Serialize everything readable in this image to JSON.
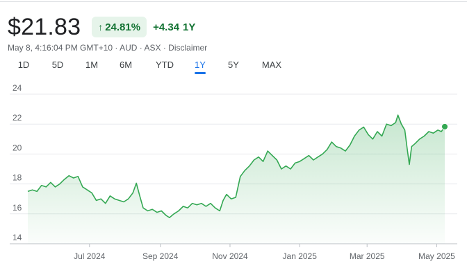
{
  "header": {
    "price": "$21.83",
    "percent_change": "24.81%",
    "arrow_icon": "arrow-up-icon",
    "arrow_glyph": "↑",
    "abs_change": "+4.34",
    "period_label": "1Y"
  },
  "meta": {
    "timestamp": "May 8, 4:16:04 PM GMT+10",
    "sep": "·",
    "currency": "AUD",
    "exchange": "ASX",
    "disclaimer": "Disclaimer"
  },
  "tabs": [
    {
      "label": "1D",
      "active": false
    },
    {
      "label": "5D",
      "active": false
    },
    {
      "label": "1M",
      "active": false
    },
    {
      "label": "6M",
      "active": false
    },
    {
      "label": "YTD",
      "active": false
    },
    {
      "label": "1Y",
      "active": true
    },
    {
      "label": "5Y",
      "active": false
    },
    {
      "label": "MAX",
      "active": false
    }
  ],
  "colors": {
    "line": "#34a853",
    "fill_top": "#34a853",
    "grid": "#e8eaed",
    "axis": "#bdc1c6",
    "accent": "#1a73e8"
  },
  "chart_data": {
    "type": "area",
    "title": "",
    "xlabel": "",
    "ylabel": "",
    "ylim": [
      14,
      24
    ],
    "yticks": [
      14,
      16,
      18,
      20,
      22,
      24
    ],
    "xlim": [
      "2024-05-08",
      "2025-05-08"
    ],
    "xticks": [
      {
        "label": "Jul 2024",
        "date": "2024-07-01"
      },
      {
        "label": "Sep 2024",
        "date": "2024-09-01"
      },
      {
        "label": "Nov 2024",
        "date": "2024-11-01"
      },
      {
        "label": "Jan 2025",
        "date": "2025-01-01"
      },
      {
        "label": "Mar 2025",
        "date": "2025-03-01"
      },
      {
        "label": "May 2025",
        "date": "2025-05-01"
      }
    ],
    "grid": true,
    "series": [
      {
        "points": [
          [
            "2024-05-08",
            17.5
          ],
          [
            "2024-05-12",
            17.6
          ],
          [
            "2024-05-16",
            17.5
          ],
          [
            "2024-05-20",
            17.9
          ],
          [
            "2024-05-24",
            17.8
          ],
          [
            "2024-05-28",
            18.1
          ],
          [
            "2024-06-01",
            17.8
          ],
          [
            "2024-06-05",
            18.0
          ],
          [
            "2024-06-09",
            18.3
          ],
          [
            "2024-06-13",
            18.55
          ],
          [
            "2024-06-17",
            18.4
          ],
          [
            "2024-06-21",
            18.5
          ],
          [
            "2024-06-25",
            17.8
          ],
          [
            "2024-06-29",
            17.6
          ],
          [
            "2024-07-03",
            17.4
          ],
          [
            "2024-07-07",
            16.9
          ],
          [
            "2024-07-11",
            17.0
          ],
          [
            "2024-07-15",
            16.7
          ],
          [
            "2024-07-19",
            17.2
          ],
          [
            "2024-07-23",
            17.0
          ],
          [
            "2024-07-27",
            16.9
          ],
          [
            "2024-07-31",
            16.8
          ],
          [
            "2024-08-04",
            17.0
          ],
          [
            "2024-08-08",
            17.4
          ],
          [
            "2024-08-11",
            18.05
          ],
          [
            "2024-08-14",
            17.2
          ],
          [
            "2024-08-17",
            16.4
          ],
          [
            "2024-08-21",
            16.2
          ],
          [
            "2024-08-25",
            16.3
          ],
          [
            "2024-08-29",
            16.1
          ],
          [
            "2024-09-02",
            16.2
          ],
          [
            "2024-09-06",
            15.9
          ],
          [
            "2024-09-09",
            15.75
          ],
          [
            "2024-09-13",
            16.0
          ],
          [
            "2024-09-17",
            16.2
          ],
          [
            "2024-09-21",
            16.5
          ],
          [
            "2024-09-25",
            16.4
          ],
          [
            "2024-09-29",
            16.7
          ],
          [
            "2024-10-03",
            16.6
          ],
          [
            "2024-10-07",
            16.7
          ],
          [
            "2024-10-11",
            16.5
          ],
          [
            "2024-10-15",
            16.7
          ],
          [
            "2024-10-19",
            16.4
          ],
          [
            "2024-10-23",
            16.2
          ],
          [
            "2024-10-26",
            16.9
          ],
          [
            "2024-10-29",
            17.3
          ],
          [
            "2024-11-02",
            17.0
          ],
          [
            "2024-11-06",
            17.1
          ],
          [
            "2024-11-10",
            18.5
          ],
          [
            "2024-11-14",
            18.9
          ],
          [
            "2024-11-18",
            19.2
          ],
          [
            "2024-11-22",
            19.6
          ],
          [
            "2024-11-26",
            19.8
          ],
          [
            "2024-11-30",
            19.5
          ],
          [
            "2024-12-04",
            20.2
          ],
          [
            "2024-12-08",
            19.9
          ],
          [
            "2024-12-12",
            19.6
          ],
          [
            "2024-12-16",
            19.0
          ],
          [
            "2024-12-20",
            19.2
          ],
          [
            "2024-12-24",
            19.0
          ],
          [
            "2024-12-28",
            19.4
          ],
          [
            "2025-01-01",
            19.5
          ],
          [
            "2025-01-05",
            19.7
          ],
          [
            "2025-01-09",
            19.9
          ],
          [
            "2025-01-13",
            19.6
          ],
          [
            "2025-01-17",
            19.8
          ],
          [
            "2025-01-21",
            20.0
          ],
          [
            "2025-01-25",
            20.3
          ],
          [
            "2025-01-29",
            20.8
          ],
          [
            "2025-02-02",
            20.5
          ],
          [
            "2025-02-06",
            20.4
          ],
          [
            "2025-02-10",
            20.2
          ],
          [
            "2025-02-14",
            20.6
          ],
          [
            "2025-02-18",
            21.2
          ],
          [
            "2025-02-22",
            21.6
          ],
          [
            "2025-02-26",
            21.8
          ],
          [
            "2025-03-02",
            21.3
          ],
          [
            "2025-03-06",
            21.0
          ],
          [
            "2025-03-10",
            21.5
          ],
          [
            "2025-03-14",
            21.2
          ],
          [
            "2025-03-18",
            22.0
          ],
          [
            "2025-03-22",
            21.9
          ],
          [
            "2025-03-26",
            22.1
          ],
          [
            "2025-03-28",
            22.6
          ],
          [
            "2025-03-31",
            22.0
          ],
          [
            "2025-04-03",
            21.6
          ],
          [
            "2025-04-05",
            20.4
          ],
          [
            "2025-04-07",
            19.3
          ],
          [
            "2025-04-09",
            20.5
          ],
          [
            "2025-04-12",
            20.7
          ],
          [
            "2025-04-16",
            21.0
          ],
          [
            "2025-04-20",
            21.2
          ],
          [
            "2025-04-24",
            21.5
          ],
          [
            "2025-04-28",
            21.4
          ],
          [
            "2025-05-02",
            21.6
          ],
          [
            "2025-05-05",
            21.5
          ],
          [
            "2025-05-08",
            21.83
          ]
        ]
      }
    ]
  }
}
